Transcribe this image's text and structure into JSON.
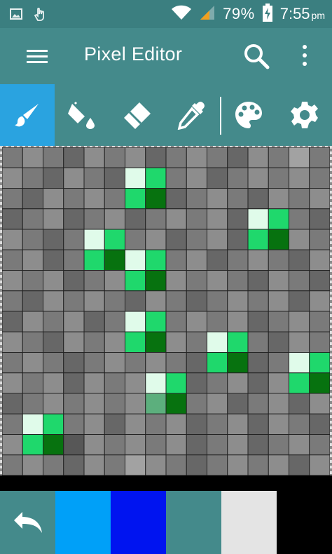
{
  "status_bar": {
    "battery_percent": "79%",
    "time": "7:55",
    "ampm": "pm",
    "icons": [
      "image-icon",
      "hand-touch-icon",
      "wifi-icon",
      "cell-signal-icon",
      "battery-charging-icon"
    ]
  },
  "app_bar": {
    "title": "Pixel Editor",
    "icons": [
      "menu-icon",
      "search-icon",
      "overflow-icon"
    ]
  },
  "toolbar": {
    "tools": [
      {
        "name": "brush",
        "icon": "brush-icon",
        "active": true
      },
      {
        "name": "fill",
        "icon": "paint-bucket-icon",
        "active": false
      },
      {
        "name": "eraser",
        "icon": "eraser-icon",
        "active": false
      },
      {
        "name": "eyedropper",
        "icon": "eyedropper-icon",
        "active": false
      },
      {
        "name": "palette",
        "icon": "palette-icon",
        "active": false
      },
      {
        "name": "settings",
        "icon": "gear-icon",
        "active": false
      }
    ],
    "active_color": "#2aa3e0"
  },
  "canvas": {
    "columns": 16,
    "rows": 16,
    "colors": {
      "a": "#a2a2a2",
      "b": "#8d8d8d",
      "c": "#7a7a7a",
      "d": "#676767",
      "e": "#575757",
      "W": "#e0fbea",
      "G": "#1fd86c",
      "D": "#07720f",
      "M": "#5caf7d"
    },
    "pixels": [
      "cbcdbcbdcbcdbcac",
      "bcdbcdWGcbdcbcbc",
      "cdbcbcGDdcbcdbcb",
      "dcbdcbdcbcbdWGcd",
      "bcdcWGcbdcbdGDbc",
      "cbdcGDWGcbdcbcdb",
      "bcbdcbGDbcbcdbcd",
      "cdbcbcdbcdcbcbdb",
      "dbcbdcWGcbcbdcbc",
      "bcdbcbGDbcWGcdbc",
      "cbcdcbcbcdGDdcWG",
      "bcbdbcbWGdcbdbGD",
      "dcbcbcbMDcbdcbdb",
      "cWGcbdbcbdcbdbcd",
      "bGDebcbcbdcbdcbc",
      "cbcdbcabcdcbcbdb"
    ]
  },
  "palette": {
    "undo_icon": "undo-icon",
    "swatches": [
      "#00a0f8",
      "#0014f0",
      "#448a8b",
      "#e4e4e4",
      "#000000"
    ]
  }
}
